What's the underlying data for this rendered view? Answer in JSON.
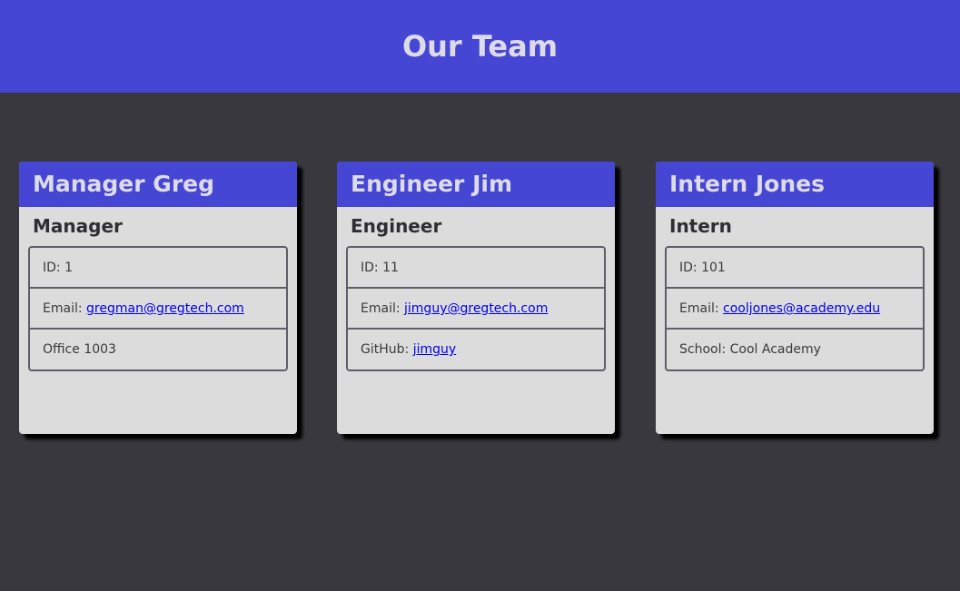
{
  "header": {
    "title": "Our Team"
  },
  "cards": [
    {
      "name": "Manager Greg",
      "role": "Manager",
      "id_label": "ID:",
      "id": "1",
      "email_label": "Email:",
      "email": "gregman@gregtech.com",
      "extra_text": "Office 1003"
    },
    {
      "name": "Engineer Jim",
      "role": "Engineer",
      "id_label": "ID:",
      "id": "11",
      "email_label": "Email:",
      "email": "jimguy@gregtech.com",
      "extra_label": "GitHub:",
      "extra_link": "jimguy"
    },
    {
      "name": "Intern Jones",
      "role": "Intern",
      "id_label": "ID:",
      "id": "101",
      "email_label": "Email:",
      "email": "cooljones@academy.edu",
      "extra_text": "School: Cool Academy"
    }
  ],
  "colors": {
    "background": "#39383e",
    "accent": "#4646d4",
    "card": "#dcdcdc",
    "link": "#0000ee"
  }
}
